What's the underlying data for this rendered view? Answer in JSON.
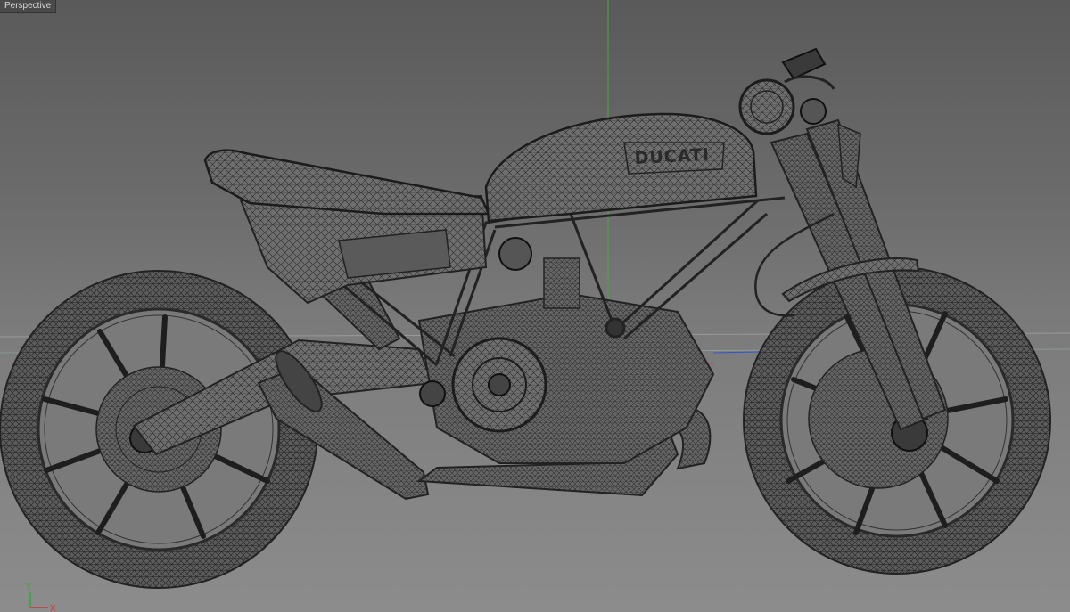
{
  "viewport": {
    "label": "Perspective"
  },
  "model": {
    "tank_logo": "DUCATI"
  },
  "axes": {
    "y_label": "Y",
    "x_label": "X",
    "x_color": "#cc3333",
    "y_color": "#33aa33",
    "z_color": "#3355cc"
  },
  "colors": {
    "wire": "#262626",
    "mesh_fill": "#6e6e6e",
    "background_top": "#5a5a5a",
    "background_bottom": "#8c8c8c"
  }
}
